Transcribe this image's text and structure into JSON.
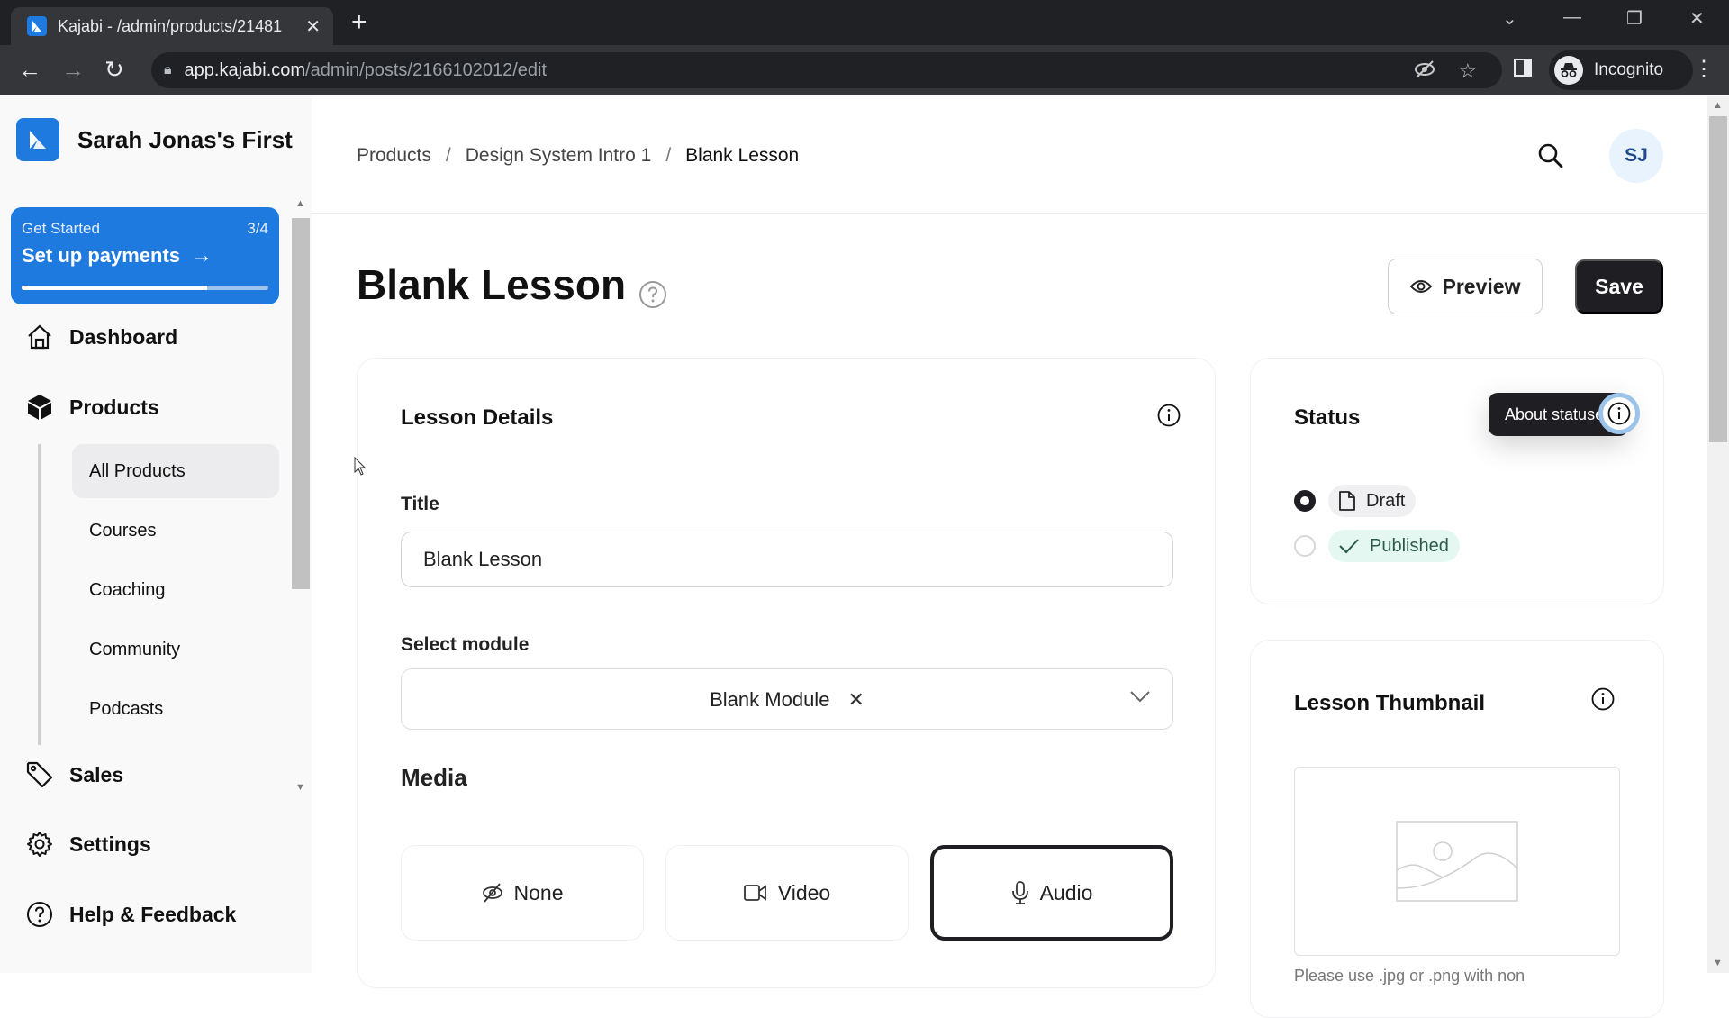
{
  "browser": {
    "tab_title": "Kajabi - /admin/products/21481",
    "tab_close": "✕",
    "new_tab": "+",
    "url_host": "app.kajabi.com",
    "url_path": "/admin/posts/2166102012/edit",
    "profile_label": "Incognito"
  },
  "sidebar": {
    "brand_name": "Sarah Jonas's First",
    "get_started": {
      "label": "Get Started",
      "step": "3/4",
      "title": "Set up payments",
      "progress": 0.75
    },
    "nav": [
      {
        "label": "Dashboard",
        "icon": "home-icon"
      },
      {
        "label": "Products",
        "icon": "box-icon"
      },
      {
        "label": "Sales",
        "icon": "tag-icon"
      },
      {
        "label": "Settings",
        "icon": "gear-icon"
      },
      {
        "label": "Help & Feedback",
        "icon": "help-icon"
      }
    ],
    "products_sub": [
      {
        "label": "All Products",
        "active": true
      },
      {
        "label": "Courses"
      },
      {
        "label": "Coaching"
      },
      {
        "label": "Community"
      },
      {
        "label": "Podcasts"
      }
    ]
  },
  "header": {
    "breadcrumbs": [
      "Products",
      "Design System Intro 1",
      "Blank Lesson"
    ],
    "separator": "/",
    "avatar_initials": "SJ"
  },
  "page": {
    "title": "Blank Lesson",
    "preview_label": "Preview",
    "save_label": "Save"
  },
  "lesson_details": {
    "heading": "Lesson Details",
    "title_label": "Title",
    "title_value": "Blank Lesson",
    "module_label": "Select module",
    "module_value": "Blank Module",
    "module_clear": "✕",
    "media_label": "Media",
    "media_options": [
      {
        "label": "None",
        "icon": "eye-off-icon",
        "selected": false
      },
      {
        "label": "Video",
        "icon": "video-icon",
        "selected": false
      },
      {
        "label": "Audio",
        "icon": "microphone-icon",
        "selected": true
      }
    ]
  },
  "status": {
    "heading": "Status",
    "tooltip": "About statuses",
    "options": [
      {
        "label": "Draft",
        "checked": true
      },
      {
        "label": "Published",
        "checked": false
      }
    ]
  },
  "thumbnail": {
    "heading": "Lesson Thumbnail",
    "help_text": "Please use .jpg or .png with non"
  },
  "colors": {
    "brand": "#1f7ae0",
    "dark_button": "#1f1f23",
    "published_bg": "#e4f8f1",
    "focus_ring": "#9cc4ea"
  }
}
